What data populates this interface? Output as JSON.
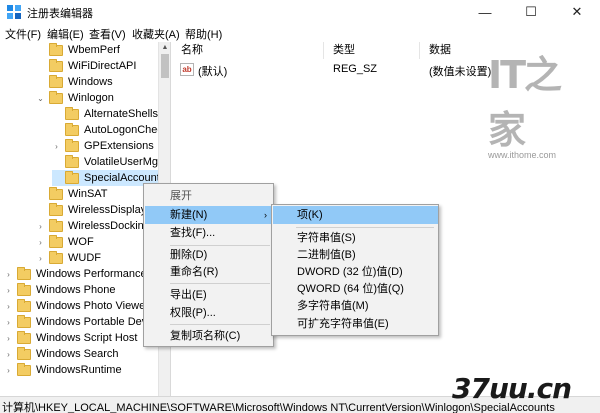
{
  "window": {
    "title": "注册表编辑器",
    "minimize": "—",
    "maximize": "☐",
    "close": "✕"
  },
  "menu": [
    "文件(F)",
    "编辑(E)",
    "查看(V)",
    "收藏夹(A)",
    "帮助(H)"
  ],
  "tree": [
    {
      "label": "WbemPerf",
      "expander": ""
    },
    {
      "label": "WiFiDirectAPI",
      "expander": ""
    },
    {
      "label": "Windows",
      "expander": ""
    },
    {
      "label": "Winlogon",
      "expander": "⌄"
    },
    {
      "label": "AlternateShells",
      "expander": ""
    },
    {
      "label": "AutoLogonCheck",
      "expander": ""
    },
    {
      "label": "GPExtensions",
      "expander": "›"
    },
    {
      "label": "VolatileUserMgr",
      "expander": ""
    },
    {
      "label": "SpecialAccounts",
      "expander": "",
      "selected": true
    },
    {
      "label": "WinSAT",
      "expander": ""
    },
    {
      "label": "WirelessDisplay",
      "expander": ""
    },
    {
      "label": "WirelessDocking",
      "expander": "›"
    },
    {
      "label": "WOF",
      "expander": "›"
    },
    {
      "label": "WUDF",
      "expander": "›"
    },
    {
      "label": "Windows Performance",
      "expander": "›"
    },
    {
      "label": "Windows Phone",
      "expander": "›"
    },
    {
      "label": "Windows Photo Viewer",
      "expander": "›"
    },
    {
      "label": "Windows Portable Devi",
      "expander": "›"
    },
    {
      "label": "Windows Script Host",
      "expander": "›"
    },
    {
      "label": "Windows Search",
      "expander": "›"
    },
    {
      "label": "WindowsRuntime",
      "expander": "›"
    }
  ],
  "columns": [
    "名称",
    "类型",
    "数据"
  ],
  "rows": [
    {
      "icon": "ab",
      "name": "(默认)",
      "type": "REG_SZ",
      "data": "(数值未设置)"
    }
  ],
  "context_menu": {
    "expand": "展开",
    "new": "新建(N)",
    "new_arrow": "›",
    "find": "查找(F)...",
    "delete": "删除(D)",
    "rename": "重命名(R)",
    "export": "导出(E)",
    "permissions": "权限(P)...",
    "copy_key_name": "复制项名称(C)"
  },
  "submenu": {
    "key": "项(K)",
    "string": "字符串值(S)",
    "binary": "二进制值(B)",
    "dword": "DWORD (32 位)值(D)",
    "qword": "QWORD (64 位)值(Q)",
    "multi_string": "多字符串值(M)",
    "expandable_string": "可扩充字符串值(E)"
  },
  "status": "计算机\\HKEY_LOCAL_MACHINE\\SOFTWARE\\Microsoft\\Windows NT\\CurrentVersion\\Winlogon\\SpecialAccounts",
  "watermark": {
    "logo": "IT之家",
    "url": "www.ithome.com",
    "corner": "37uu.cn"
  },
  "colors": {
    "highlight": "#91c9f7",
    "selected_row": "#cce8ff",
    "folder": "#f3cc62"
  }
}
